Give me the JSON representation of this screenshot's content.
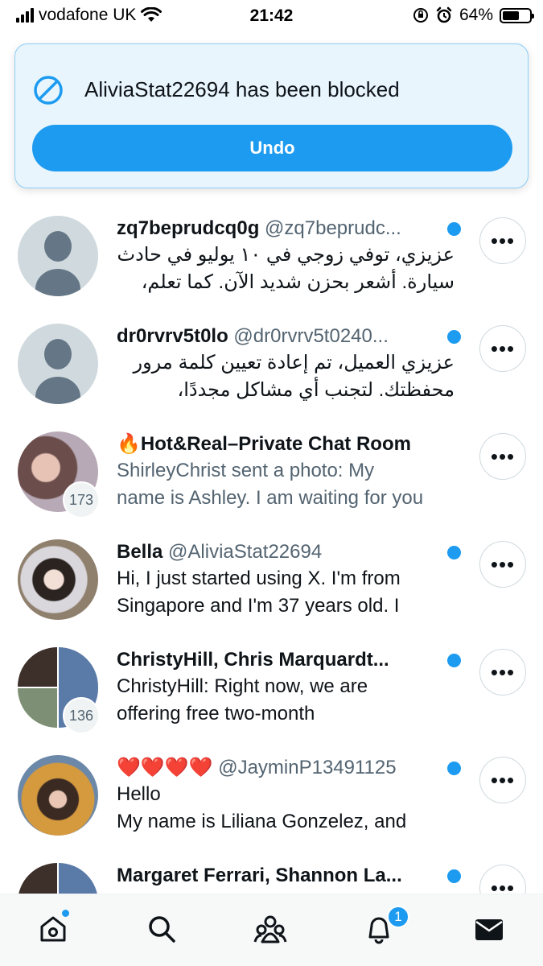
{
  "status_bar": {
    "carrier": "vodafone UK",
    "time": "21:42",
    "battery_percent": "64%",
    "battery_level": 0.64,
    "icons": [
      "signal-icon",
      "wifi-icon",
      "orientation-lock-icon",
      "alarm-icon",
      "battery-icon"
    ]
  },
  "toast": {
    "message": "AliviaStat22694 has been blocked",
    "undo_label": "Undo",
    "icon": "blocked-icon"
  },
  "conversations": [
    {
      "name": "zq7beprudcq0g",
      "handle": "@zq7beprudc...",
      "preview_rtl": true,
      "preview_lines": [
        "عزيزي، توفي زوجي في ١٠ يوليو في حادث",
        "سيارة. أشعر بحزن شديد الآن. كما تعلم،"
      ],
      "unread": true,
      "avatar": "default-avatar"
    },
    {
      "name": "dr0rvrv5t0lo",
      "handle": "@dr0rvrv5t0240...",
      "preview_rtl": true,
      "preview_lines": [
        "عزيزي العميل، تم إعادة تعيين كلمة مرور",
        "محفظتك. لتجنب أي مشاكل مجددًا،"
      ],
      "unread": true,
      "avatar": "default-avatar"
    },
    {
      "name": "🔥Hot&Real–Private Chat Room",
      "handle": "",
      "preview_rtl": false,
      "preview_muted": true,
      "preview_lines": [
        "ShirleyChrist sent a photo: My",
        "name is Ashley. I am waiting for you"
      ],
      "unread": false,
      "badge_count": "173",
      "avatar": "group-photo-avatar"
    },
    {
      "name": "Bella",
      "handle": "@AliviaStat22694",
      "preview_rtl": false,
      "preview_lines": [
        "Hi, I just started using X. I'm from",
        "Singapore and I'm 37 years old. I"
      ],
      "unread": true,
      "avatar": "photo-avatar"
    },
    {
      "name": "ChristyHill, Chris Marquardt...",
      "handle": "",
      "preview_rtl": false,
      "preview_lines": [
        "ChristyHill: Right now, we are",
        "offering free two-month"
      ],
      "unread": true,
      "badge_count": "136",
      "avatar": "group-avatar"
    },
    {
      "name": "❤️❤️❤️❤️",
      "handle": "@JayminP13491125",
      "preview_rtl": false,
      "preview_lines": [
        "Hello",
        "My name is Liliana Gonzelez, and"
      ],
      "unread": true,
      "avatar": "photo-avatar"
    },
    {
      "name": "Margaret Ferrari, Shannon La...",
      "handle": "",
      "preview_rtl": false,
      "preview_lines": [
        "",
        ""
      ],
      "unread": true,
      "avatar": "group-avatar"
    }
  ],
  "more_button_label": "•••",
  "tab_bar": {
    "tabs": [
      "home-icon",
      "search-icon",
      "communities-icon",
      "notifications-icon",
      "messages-icon"
    ],
    "notifications_count": "1",
    "active": "messages"
  }
}
